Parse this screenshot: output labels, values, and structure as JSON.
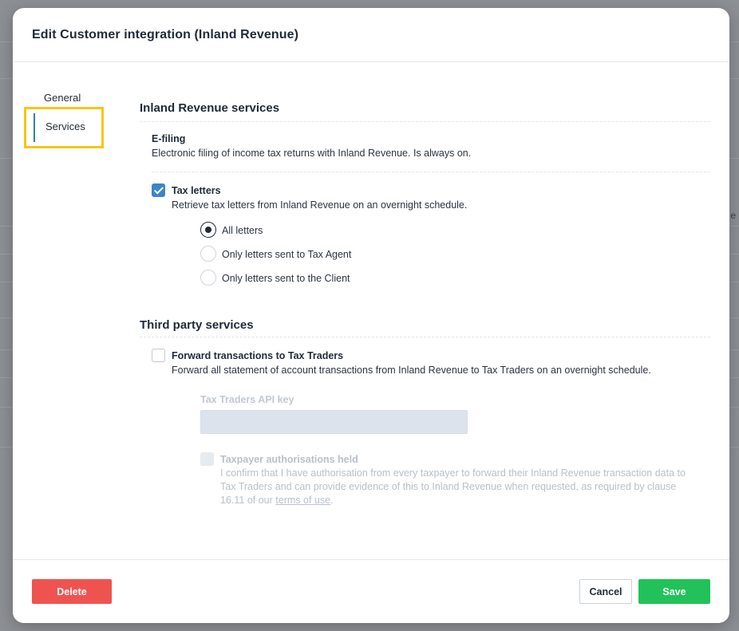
{
  "modal": {
    "title": "Edit Customer integration (Inland Revenue)"
  },
  "nav": {
    "items": [
      {
        "label": "General",
        "active": false
      },
      {
        "label": "Services",
        "active": true
      }
    ]
  },
  "sections": {
    "inland": {
      "title": "Inland Revenue services",
      "efiling": {
        "title": "E-filing",
        "desc": "Electronic filing of income tax returns with Inland Revenue. Is always on."
      },
      "tax_letters": {
        "checked": true,
        "title": "Tax letters",
        "desc": "Retrieve tax letters from Inland Revenue on an overnight schedule.",
        "options": [
          {
            "label": "All letters",
            "selected": true
          },
          {
            "label": "Only letters sent to Tax Agent",
            "selected": false
          },
          {
            "label": "Only letters sent to the Client",
            "selected": false
          }
        ]
      }
    },
    "third_party": {
      "title": "Third party services",
      "forward": {
        "checked": false,
        "title": "Forward transactions to Tax Traders",
        "desc": "Forward all statement of account transactions from Inland Revenue to Tax Traders on an overnight schedule."
      },
      "api_key": {
        "label": "Tax Traders API key",
        "value": ""
      },
      "authorisation": {
        "checked": false,
        "title": "Taxpayer authorisations held",
        "text_before": "I confirm that I have authorisation from every taxpayer to forward their Inland Revenue transaction data to Tax Traders and can provide evidence of this to Inland Revenue when requested, as required by clause 16.11 of our",
        "link": "terms of use",
        "text_after": "."
      }
    }
  },
  "footer": {
    "delete_label": "Delete",
    "cancel_label": "Cancel",
    "save_label": "Save"
  },
  "colors": {
    "primary": "#3b86c6",
    "delete": "#ef5350",
    "save": "#22c25a",
    "highlight": "#f5c518"
  },
  "background": {
    "edge_glyph": "e"
  }
}
